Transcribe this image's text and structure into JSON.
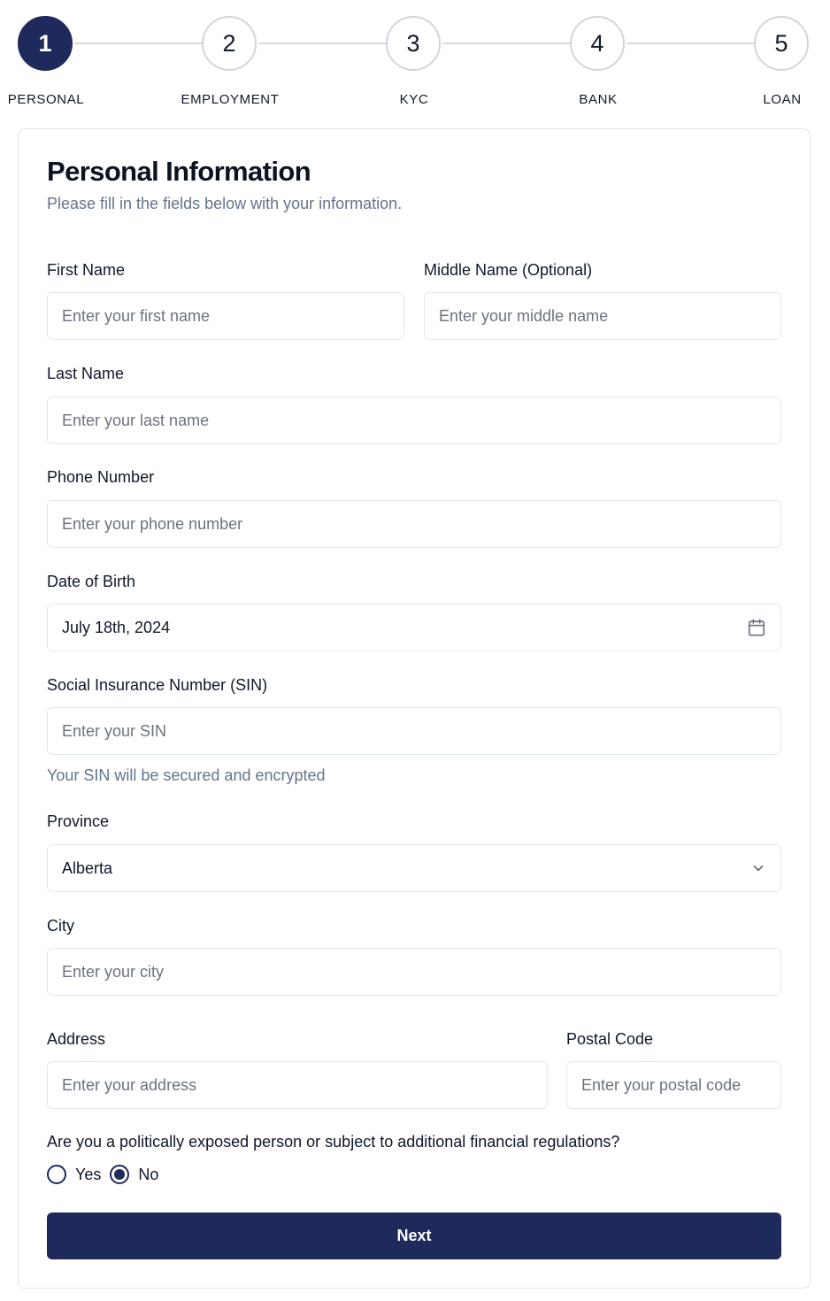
{
  "stepper": {
    "steps": [
      {
        "number": "1",
        "label": "PERSONAL",
        "active": true
      },
      {
        "number": "2",
        "label": "EMPLOYMENT",
        "active": false
      },
      {
        "number": "3",
        "label": "KYC",
        "active": false
      },
      {
        "number": "4",
        "label": "BANK",
        "active": false
      },
      {
        "number": "5",
        "label": "LOAN",
        "active": false
      }
    ]
  },
  "form": {
    "title": "Personal Information",
    "subtitle": "Please fill in the fields below with your information.",
    "first_name": {
      "label": "First Name",
      "placeholder": "Enter your first name"
    },
    "middle_name": {
      "label": "Middle Name (Optional)",
      "placeholder": "Enter your middle name"
    },
    "last_name": {
      "label": "Last Name",
      "placeholder": "Enter your last name"
    },
    "phone": {
      "label": "Phone Number",
      "placeholder": "Enter your phone number"
    },
    "dob": {
      "label": "Date of Birth",
      "value": "July 18th, 2024",
      "icon": "calendar-icon"
    },
    "sin": {
      "label": "Social Insurance Number (SIN)",
      "placeholder": "Enter your SIN",
      "hint": "Your SIN will be secured and encrypted"
    },
    "province": {
      "label": "Province",
      "value": "Alberta",
      "icon": "chevron-down-icon"
    },
    "city": {
      "label": "City",
      "placeholder": "Enter your city"
    },
    "address": {
      "label": "Address",
      "placeholder": "Enter your address"
    },
    "postal_code": {
      "label": "Postal Code",
      "placeholder": "Enter your postal code"
    },
    "pep": {
      "question": "Are you a politically exposed person or subject to additional financial regulations?",
      "options": [
        {
          "label": "Yes",
          "checked": false
        },
        {
          "label": "No",
          "checked": true
        }
      ]
    },
    "next_label": "Next"
  },
  "colors": {
    "primary": "#1e2a5c",
    "border": "#e2e8f0",
    "muted": "#64748b"
  }
}
